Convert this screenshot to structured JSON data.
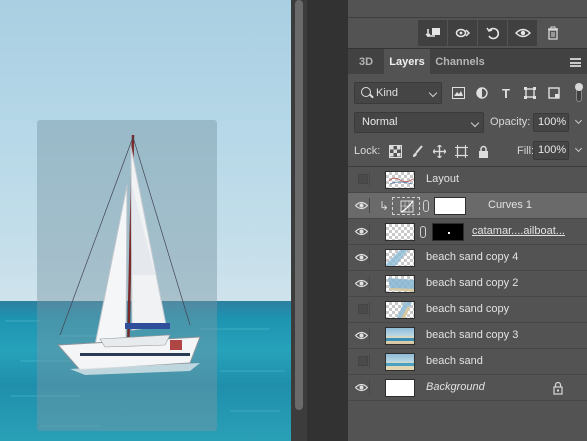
{
  "toolbar": {
    "icons": [
      "collapse-icon",
      "link-layers-icon",
      "reset-icon",
      "visibility-icon",
      "trash-icon"
    ]
  },
  "tabs": {
    "tab_3d": "3D",
    "layers": "Layers",
    "channels": "Channels",
    "active": "Layers"
  },
  "filter": {
    "kind": "Kind"
  },
  "blend": {
    "mode": "Normal",
    "opacity_label": "Opacity:",
    "opacity_value": "100%"
  },
  "lock": {
    "label": "Lock:",
    "fill_label": "Fill:",
    "fill_value": "100%"
  },
  "layers": [
    {
      "name": "Layout",
      "visible": false,
      "thumb": "checker-sketch"
    },
    {
      "name": "Curves 1",
      "visible": true,
      "selected": true,
      "thumb": "curves-adjustment",
      "mask": "white"
    },
    {
      "name": "catamar....ailboat...",
      "visible": true,
      "thumb": "checker",
      "mask": "black"
    },
    {
      "name": "beach sand copy 4",
      "visible": true,
      "thumb": "beach"
    },
    {
      "name": "beach sand copy 2",
      "visible": true,
      "thumb": "beach"
    },
    {
      "name": "beach sand copy",
      "visible": false,
      "thumb": "beach"
    },
    {
      "name": "beach sand copy 3",
      "visible": true,
      "thumb": "beach"
    },
    {
      "name": "beach sand",
      "visible": false,
      "thumb": "beach"
    },
    {
      "name": "Background",
      "visible": true,
      "thumb": "white",
      "locked": true
    }
  ],
  "colors": {
    "panel_bg": "#535353",
    "selected_row": "#6a6a6a",
    "sea": "#1d93b0",
    "sky": "#b6d8e8"
  }
}
